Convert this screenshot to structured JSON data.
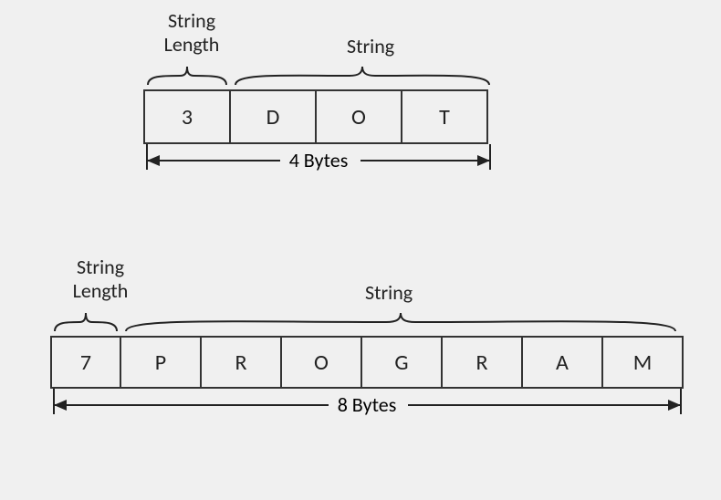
{
  "diagram1": {
    "lengthLabel": "String\nLength",
    "stringLabel": "String",
    "bytesLabel": "4 Bytes",
    "cells": [
      "3",
      "D",
      "O",
      "T"
    ]
  },
  "diagram2": {
    "lengthLabel": "String\nLength",
    "stringLabel": "String",
    "bytesLabel": "8 Bytes",
    "cells": [
      "7",
      "P",
      "R",
      "O",
      "G",
      "R",
      "A",
      "M"
    ]
  }
}
